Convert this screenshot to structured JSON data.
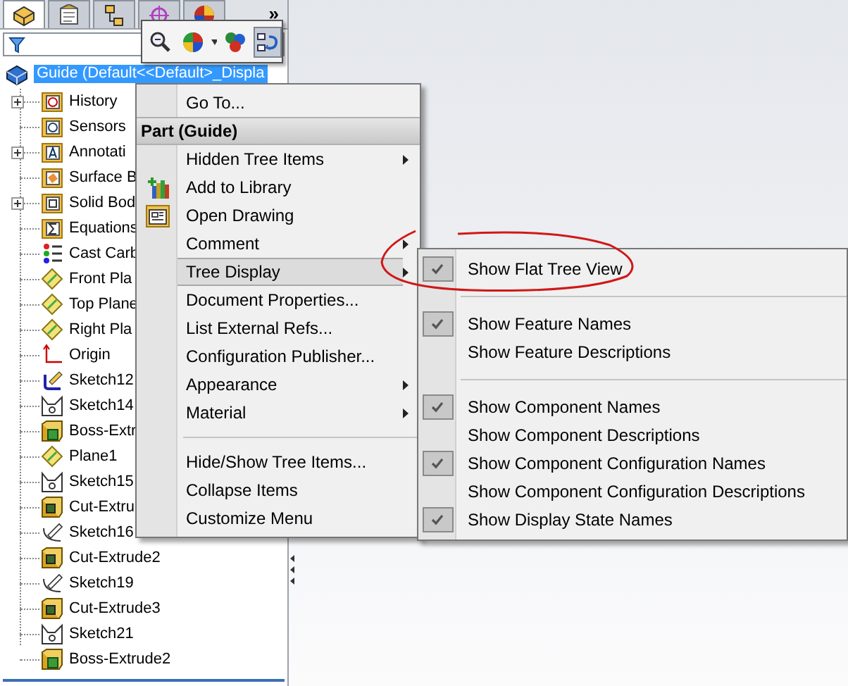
{
  "panel_tabs": [
    {
      "selected": true
    },
    {
      "selected": false
    },
    {
      "selected": false
    },
    {
      "selected": false
    },
    {
      "selected": false
    }
  ],
  "panel_tabs_more": "»",
  "tree": {
    "root": "Guide  (Default<<Default>_Displa",
    "items": [
      {
        "label": "History",
        "kind": "history",
        "expandable": true
      },
      {
        "label": "Sensors",
        "kind": "sensors",
        "expandable": false
      },
      {
        "label": "Annotati",
        "kind": "annotations",
        "expandable": true
      },
      {
        "label": "Surface B",
        "kind": "surface",
        "expandable": false
      },
      {
        "label": "Solid Bod",
        "kind": "solid",
        "expandable": true
      },
      {
        "label": "Equations",
        "kind": "equations",
        "expandable": false
      },
      {
        "label": "Cast Carb",
        "kind": "material",
        "expandable": false
      },
      {
        "label": "Front Pla",
        "kind": "plane",
        "expandable": false
      },
      {
        "label": "Top Plane",
        "kind": "plane",
        "expandable": false
      },
      {
        "label": "Right Pla",
        "kind": "plane",
        "expandable": false
      },
      {
        "label": "Origin",
        "kind": "origin",
        "expandable": false
      },
      {
        "label": "Sketch12",
        "kind": "sketch-edit",
        "expandable": false
      },
      {
        "label": "Sketch14",
        "kind": "sketch",
        "expandable": false
      },
      {
        "label": "Boss-Extr",
        "kind": "boss",
        "expandable": false
      },
      {
        "label": "Plane1",
        "kind": "plane",
        "expandable": false
      },
      {
        "label": "Sketch15",
        "kind": "sketch",
        "expandable": false
      },
      {
        "label": "Cut-Extru",
        "kind": "cut",
        "expandable": false
      },
      {
        "label": "Sketch16",
        "kind": "sketch-open",
        "expandable": false
      },
      {
        "label": "Cut-Extrude2",
        "kind": "cut",
        "expandable": false
      },
      {
        "label": "Sketch19",
        "kind": "sketch-open",
        "expandable": false
      },
      {
        "label": "Cut-Extrude3",
        "kind": "cut",
        "expandable": false
      },
      {
        "label": "Sketch21",
        "kind": "sketch",
        "expandable": false
      },
      {
        "label": "Boss-Extrude2",
        "kind": "boss",
        "expandable": false
      }
    ]
  },
  "toolbar": {
    "buttons": [
      {
        "kind": "zoom",
        "selected": false
      },
      {
        "kind": "appearance",
        "selected": false
      },
      {
        "kind": "scene",
        "selected": false
      },
      {
        "kind": "tree",
        "selected": true
      }
    ]
  },
  "context_menu": {
    "items": [
      {
        "kind": "item",
        "label": "Go To...",
        "submenu": false,
        "selected": false,
        "icon": false
      },
      {
        "kind": "header",
        "label": "Part (Guide)"
      },
      {
        "kind": "item",
        "label": "Hidden Tree Items",
        "submenu": true,
        "selected": false,
        "icon": false
      },
      {
        "kind": "item",
        "label": "Add to Library",
        "submenu": false,
        "selected": false,
        "icon": true
      },
      {
        "kind": "item",
        "label": "Open Drawing",
        "submenu": false,
        "selected": false,
        "icon": true
      },
      {
        "kind": "item",
        "label": "Comment",
        "submenu": true,
        "selected": false,
        "icon": false
      },
      {
        "kind": "item",
        "label": "Tree Display",
        "submenu": true,
        "selected": true,
        "icon": false
      },
      {
        "kind": "item",
        "label": "Document Properties...",
        "submenu": false,
        "selected": false,
        "icon": false
      },
      {
        "kind": "item",
        "label": "List External Refs...",
        "submenu": false,
        "selected": false,
        "icon": false
      },
      {
        "kind": "item",
        "label": "Configuration Publisher...",
        "submenu": false,
        "selected": false,
        "icon": false
      },
      {
        "kind": "item",
        "label": "Appearance",
        "submenu": true,
        "selected": false,
        "icon": false
      },
      {
        "kind": "item",
        "label": "Material",
        "submenu": true,
        "selected": false,
        "icon": false
      },
      {
        "kind": "separator"
      },
      {
        "kind": "item",
        "label": "Hide/Show Tree Items...",
        "submenu": false,
        "selected": false,
        "icon": false
      },
      {
        "kind": "item",
        "label": "Collapse Items",
        "submenu": false,
        "selected": false,
        "icon": false
      },
      {
        "kind": "item",
        "label": "Customize Menu",
        "submenu": false,
        "selected": false,
        "icon": false
      }
    ]
  },
  "submenu": {
    "items": [
      {
        "kind": "item",
        "label": "Show Flat Tree View",
        "checked": true
      },
      {
        "kind": "separator"
      },
      {
        "kind": "item",
        "label": "Show Feature Names",
        "checked": true
      },
      {
        "kind": "item",
        "label": "Show Feature Descriptions",
        "checked": false
      },
      {
        "kind": "separator"
      },
      {
        "kind": "item",
        "label": "Show Component Names",
        "checked": true
      },
      {
        "kind": "item",
        "label": "Show Component Descriptions",
        "checked": false
      },
      {
        "kind": "item",
        "label": "Show Component Configuration Names",
        "checked": true
      },
      {
        "kind": "item",
        "label": "Show Component Configuration Descriptions",
        "checked": false
      },
      {
        "kind": "item",
        "label": "Show Display State Names",
        "checked": true
      }
    ]
  }
}
